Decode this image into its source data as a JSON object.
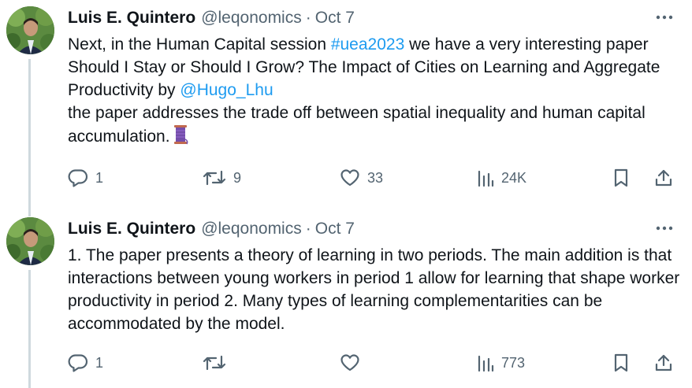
{
  "tweets": [
    {
      "author": {
        "name": "Luis E. Quintero",
        "handle": "@leqonomics",
        "separator": "·",
        "date": "Oct 7"
      },
      "avatar_icon": "profile-photo",
      "more_icon": "more-horizontal-icon",
      "text": {
        "part1": "Next, in the Human Capital session ",
        "hashtag": "#uea2023",
        "part2": " we have a very interesting paper Should I Stay or Should I Grow? The Impact of Cities on Learning and Aggregate Productivity by ",
        "mention": "@Hugo_Lhu",
        "line2": "the paper addresses the trade off between spatial inequality and human capital accumulation."
      },
      "emoji": "thread-spool-emoji",
      "stats": {
        "replies": "1",
        "reposts": "9",
        "likes": "33",
        "views": "24K"
      }
    },
    {
      "author": {
        "name": "Luis E. Quintero",
        "handle": "@leqonomics",
        "separator": "·",
        "date": "Oct 7"
      },
      "avatar_icon": "profile-photo",
      "more_icon": "more-horizontal-icon",
      "text": {
        "body": "1. The paper presents a theory of learning in two periods. The main addition is that interactions between young workers in period 1 allow for learning that shape worker productivity in period 2. Many types of learning complementarities can be accommodated by the model."
      },
      "stats": {
        "replies": "1",
        "reposts": "",
        "likes": "",
        "views": "773"
      }
    }
  ],
  "colors": {
    "text": "#0f1419",
    "secondary": "#536471",
    "link": "#1d9bf0",
    "thread_line": "#cfd9de"
  }
}
